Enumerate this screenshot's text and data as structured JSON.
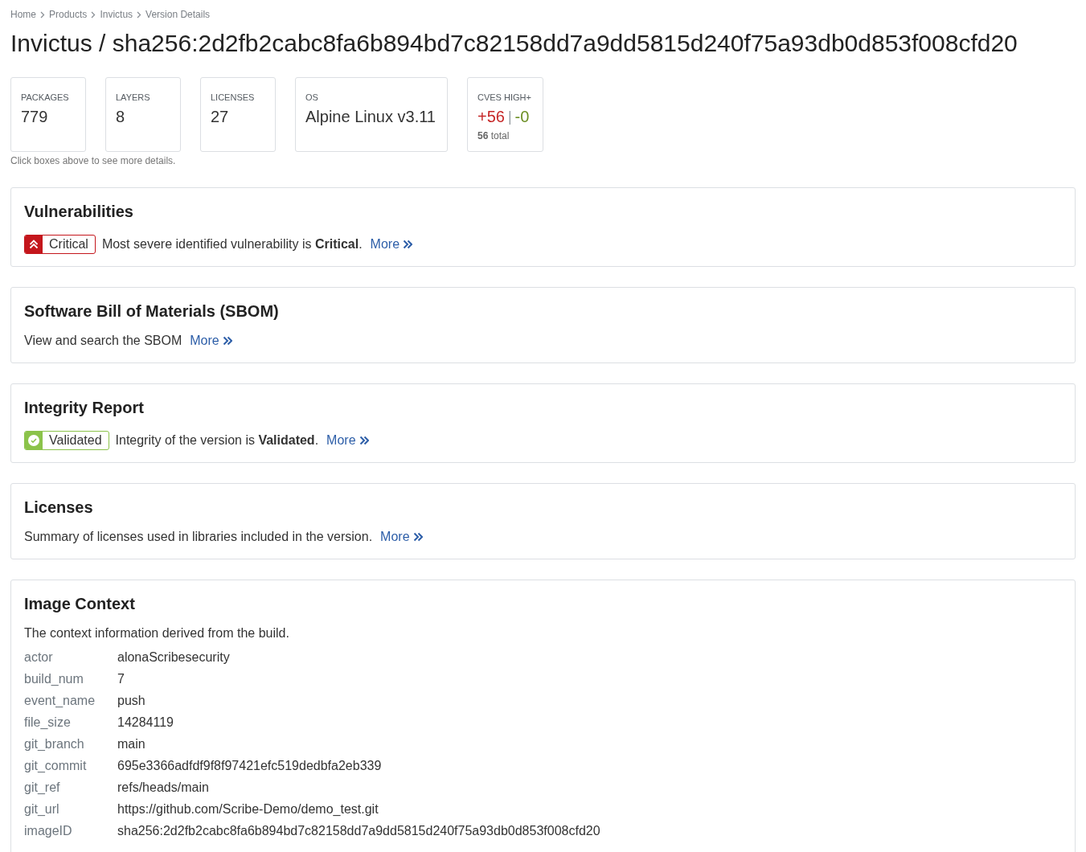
{
  "breadcrumb": [
    {
      "label": "Home"
    },
    {
      "label": "Products"
    },
    {
      "label": "Invictus"
    },
    {
      "label": "Version Details"
    }
  ],
  "title": "Invictus / sha256:2d2fb2cabc8fa6b894bd7c82158dd7a9dd5815d240f75a93db0d853f008cfd20",
  "stats": [
    {
      "kind": "plain",
      "label": "PACKAGES",
      "value": "779"
    },
    {
      "kind": "plain",
      "label": "LAYERS",
      "value": "8"
    },
    {
      "kind": "plain",
      "label": "LICENSES",
      "value": "27"
    },
    {
      "kind": "plain",
      "label": "OS",
      "value": "Alpine Linux v3.11"
    },
    {
      "kind": "cves",
      "label": "CVES HIGH+",
      "added": "+56",
      "divider": "|",
      "removed": "-0",
      "total": "**56** total"
    }
  ],
  "stats_note": "Click boxes above to see more details.",
  "sections": [
    {
      "kind": "status",
      "title": "Vulnerabilities",
      "badge": {
        "kind": "critical",
        "label": "Critical"
      },
      "text": "Most severe identified vulnerability is **Critical**.",
      "link": "More"
    },
    {
      "kind": "text",
      "title": "Software Bill of Materials (SBOM)",
      "text": "View and search the SBOM",
      "link": "More"
    },
    {
      "kind": "status",
      "title": "Integrity Report",
      "badge": {
        "kind": "validated",
        "label": "Validated"
      },
      "text": "Integrity of the version is **Validated**.",
      "link": "More"
    },
    {
      "kind": "text",
      "title": "Licenses",
      "text": "Summary of licenses used in libraries included in the version.",
      "link": "More"
    },
    {
      "kind": "context",
      "title": "Image Context",
      "text": "The context information derived from the build.",
      "rows": [
        {
          "key": "actor",
          "value": "alonaScribesecurity"
        },
        {
          "key": "build_num",
          "value": "7"
        },
        {
          "key": "event_name",
          "value": "push"
        },
        {
          "key": "file_size",
          "value": "14284119"
        },
        {
          "key": "git_branch",
          "value": "main"
        },
        {
          "key": "git_commit",
          "value": "695e3366adfdf9f8f97421efc519dedbfa2eb339"
        },
        {
          "key": "git_ref",
          "value": "refs/heads/main"
        },
        {
          "key": "git_url",
          "value": "https://github.com/Scribe-Demo/demo_test.git"
        },
        {
          "key": "imageID",
          "value": "sha256:2d2fb2cabc8fa6b894bd7c82158dd7a9dd5815d240f75a93db0d853f008cfd20"
        }
      ]
    }
  ]
}
